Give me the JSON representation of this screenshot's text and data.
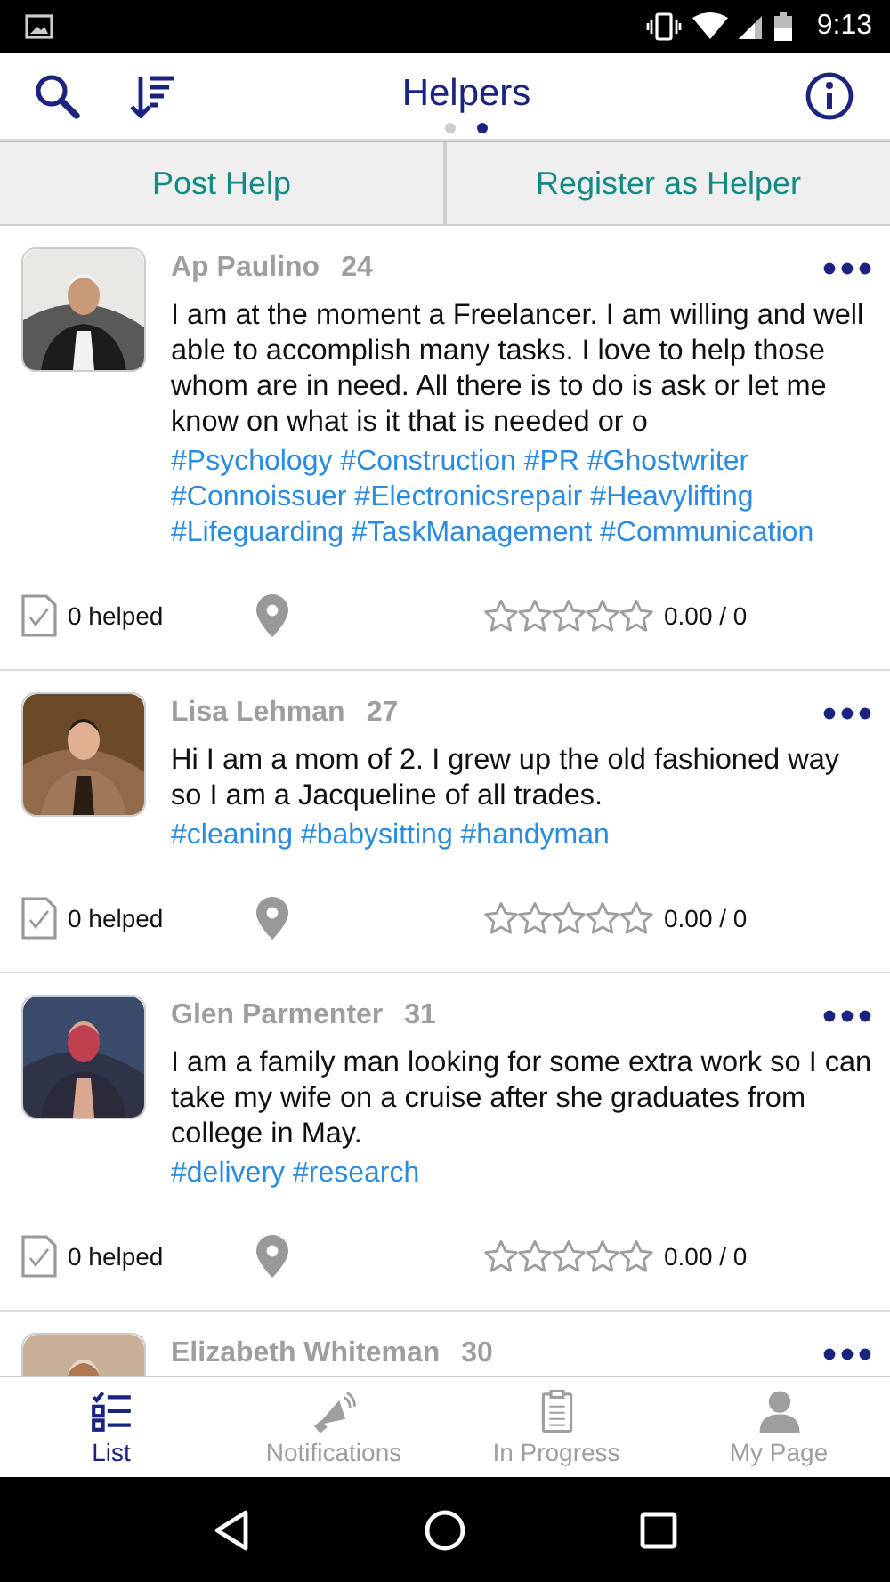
{
  "status_bar": {
    "time": "9:13"
  },
  "header": {
    "title": "Helpers",
    "pages": [
      {
        "selected": false
      },
      {
        "selected": true
      }
    ]
  },
  "actions": [
    "Post Help",
    "Register as Helper"
  ],
  "helpers": [
    {
      "name": "Ap Paulino",
      "age": "24",
      "bio": "I am at the moment a Freelancer. I am willing and well able to accomplish many  tasks. I love to help those whom are in need. All there is to do is ask or let me know on what is it that is needed or o",
      "tags": "#Psychology #Construction #PR #Ghostwriter #Connoissuer #Electronicsrepair #Heavylifting #Lifeguarding #TaskManagement #Communication",
      "helped": "0 helped",
      "stars": 0,
      "rating": "0.00 / 0"
    },
    {
      "name": "Lisa Lehman",
      "age": "27",
      "bio": "Hi I am a mom of 2. I grew up the old fashioned way so I am a Jacqueline of all trades.",
      "tags": "#cleaning #babysitting #handyman",
      "helped": "0 helped",
      "stars": 0,
      "rating": "0.00 / 0"
    },
    {
      "name": "Glen Parmenter",
      "age": "31",
      "bio": "I am a family man looking for some extra work so I can take my wife on a cruise after she graduates from college in May.",
      "tags": "#delivery #research",
      "helped": "0 helped",
      "stars": 0,
      "rating": "0.00 / 0"
    },
    {
      "name": "Elizabeth Whiteman",
      "age": "30"
    }
  ],
  "tabs": [
    {
      "label": "List",
      "kind": "list",
      "selected": true
    },
    {
      "label": "Notifications",
      "kind": "megaphone",
      "selected": false
    },
    {
      "label": "In Progress",
      "kind": "clipboard",
      "selected": false
    },
    {
      "label": "My Page",
      "kind": "person",
      "selected": false
    }
  ]
}
